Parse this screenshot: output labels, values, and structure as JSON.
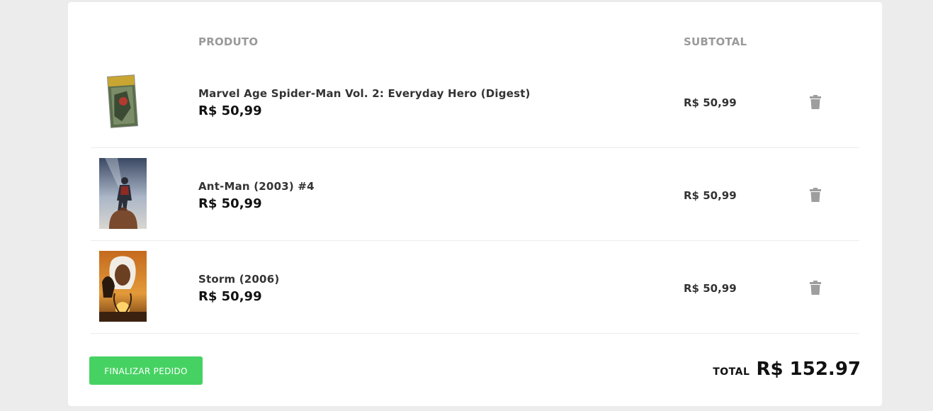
{
  "table": {
    "col_product": "PRODUTO",
    "col_subtotal": "SUBTOTAL"
  },
  "items": [
    {
      "name": "Marvel Age Spider-Man Vol. 2: Everyday Hero (Digest)",
      "price": "R$ 50,99",
      "subtotal": "R$ 50,99",
      "image": "comic-cover-spiderman"
    },
    {
      "name": "Ant-Man (2003) #4",
      "price": "R$ 50,99",
      "subtotal": "R$ 50,99",
      "image": "comic-cover-antman"
    },
    {
      "name": "Storm (2006)",
      "price": "R$ 50,99",
      "subtotal": "R$ 50,99",
      "image": "comic-cover-storm"
    }
  ],
  "actions": {
    "finish_label": "FINALIZAR PEDIDO",
    "finish_color": "#46d263"
  },
  "summary": {
    "total_label": "TOTAL",
    "total_value": "R$ 152.97"
  },
  "icons": {
    "remove": "trash-icon"
  }
}
